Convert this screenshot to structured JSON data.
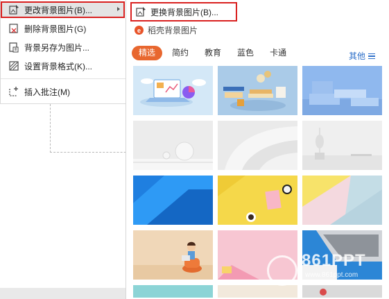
{
  "context_menu": {
    "items": [
      {
        "label": "更改背景图片(B)...",
        "icon": "change-background-icon"
      },
      {
        "label": "删除背景图片(G)",
        "icon": "delete-background-icon"
      },
      {
        "label": "背景另存为图片...",
        "icon": "save-background-icon"
      },
      {
        "label": "设置背景格式(K)...",
        "icon": "background-format-icon"
      },
      {
        "label": "插入批注(M)",
        "icon": "insert-comment-icon"
      }
    ]
  },
  "submenu": {
    "replace_label": "更换背景图片(B)...",
    "brand_logo": "e",
    "brand_label": "稻壳背景图片",
    "tabs": [
      "精选",
      "简约",
      "教育",
      "蓝色",
      "卡通"
    ],
    "selected_tab": "精选",
    "more_label": "其他",
    "thumbnails": [
      "laptop-chart-3d",
      "education-3d",
      "blue-podium-3d",
      "white-sphere",
      "white-curves",
      "white-room-plant",
      "blue-geometric",
      "yellow-desk-clock",
      "pastel-blocks",
      "cartoon-girl-chair",
      "pink-laptop",
      "pink-cart",
      "teal-partial",
      "light-partial",
      "gray-partial"
    ]
  },
  "watermark": {
    "main": "861PPT",
    "sub": "www.861ppt.com"
  },
  "colors": {
    "highlight_border": "#d9201f",
    "tab_selected": "#e8672f",
    "more_link": "#2d6fc9"
  }
}
